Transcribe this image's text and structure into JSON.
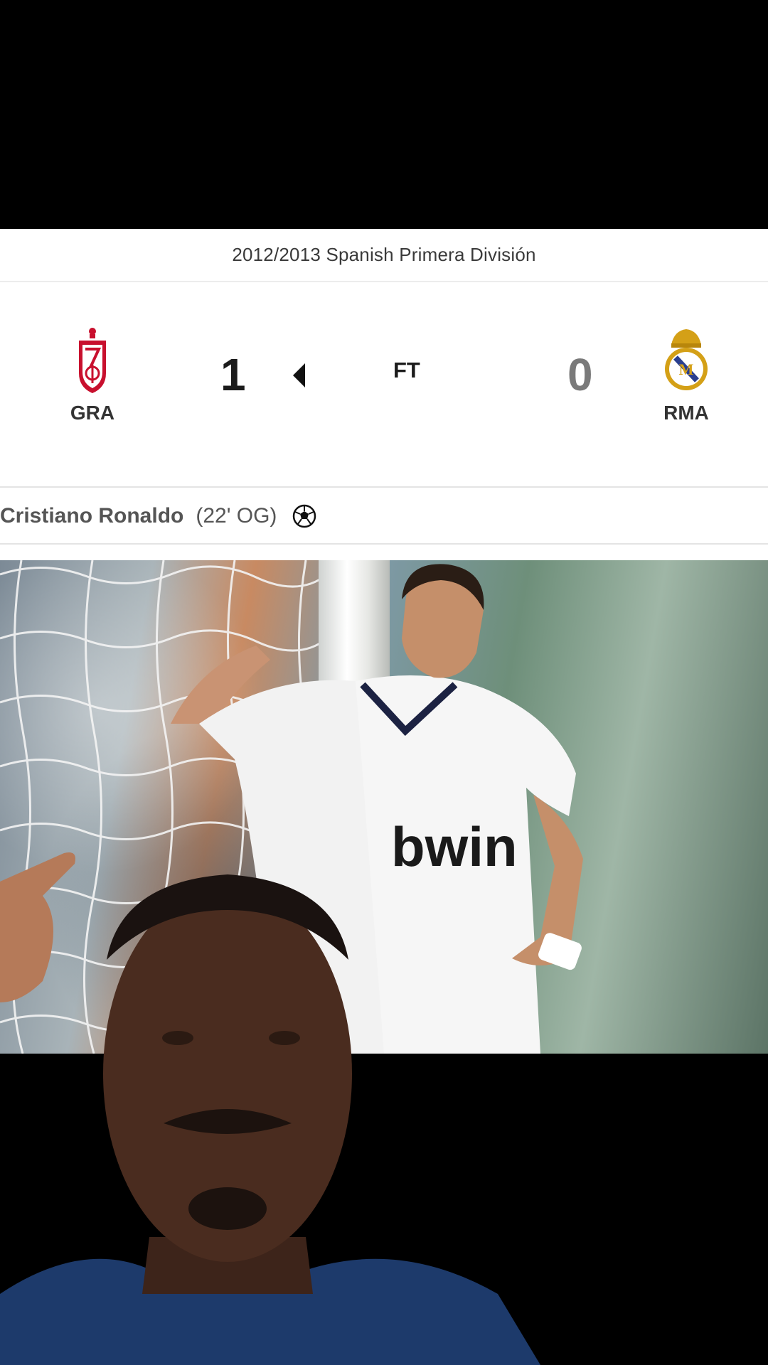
{
  "match": {
    "competition": "2012/2013 Spanish Primera División",
    "home": {
      "abbr": "GRA",
      "score": "1",
      "crest": "granada-crest-icon"
    },
    "away": {
      "abbr": "RMA",
      "score": "0",
      "crest": "real-madrid-crest-icon"
    },
    "status": "FT",
    "winner_indicator": "arrow-left-icon"
  },
  "events": [
    {
      "player": "Cristiano Ronaldo",
      "detail": "(22' OG)",
      "icon": "soccer-ball-icon"
    }
  ],
  "media": {
    "photo_subject": "football-player-photo",
    "overlay": "reaction-person-overlay"
  },
  "colors": {
    "background": "#000000",
    "card": "#ffffff",
    "home_score": "#1b1b1b",
    "away_score": "#7a7a7a",
    "granada_red": "#c8102e",
    "madrid_gold": "#d4a017"
  }
}
